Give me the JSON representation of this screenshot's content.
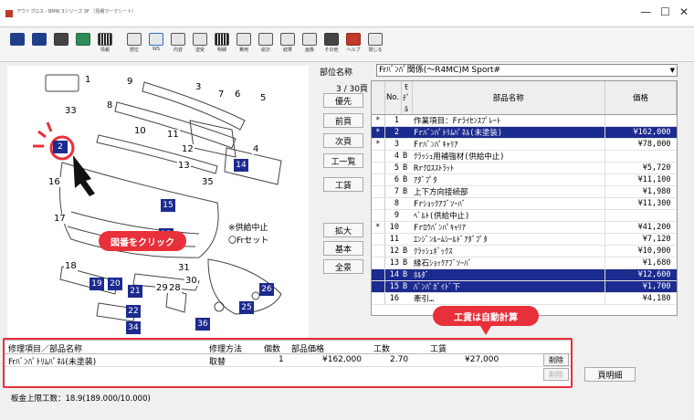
{
  "window": {
    "title": "アウトプロス - BMW 3シリーズ 3F （見積ワークシート）",
    "controls": [
      "—",
      "☐",
      "✕"
    ]
  },
  "toolbar": {
    "buttons": [
      {
        "icon": "save-icon",
        "label": ""
      },
      {
        "icon": "save-as-icon",
        "label": ""
      },
      {
        "icon": "print-icon",
        "label": ""
      },
      {
        "icon": "exit-icon",
        "label": ""
      },
      {
        "icon": "info-icon",
        "label": "情報"
      },
      {
        "icon": "parts-icon",
        "label": "部位"
      },
      {
        "icon": "ws-icon",
        "label": "WS"
      },
      {
        "icon": "internal-icon",
        "label": "内容"
      },
      {
        "icon": "transfer-icon",
        "label": "送受"
      },
      {
        "icon": "detail-icon",
        "label": "明細"
      },
      {
        "icon": "cost-icon",
        "label": "費用"
      },
      {
        "icon": "total-icon",
        "label": "総計"
      },
      {
        "icon": "result-icon",
        "label": "結果"
      },
      {
        "icon": "image-icon",
        "label": "画像"
      },
      {
        "icon": "other-icon",
        "label": "その他"
      },
      {
        "icon": "help-icon",
        "label": "ヘルプ"
      },
      {
        "icon": "close-icon",
        "label": "閉じる"
      }
    ]
  },
  "diagram": {
    "callout": "図番をクリック",
    "legend_discontinued": "※供給中止",
    "legend_set": "〇Frセット",
    "selected_number": "2",
    "numbers_plain": [
      "1",
      "3",
      "7",
      "6",
      "5",
      "8",
      "9",
      "10",
      "4",
      "11",
      "12",
      "13",
      "16",
      "17",
      "18",
      "31",
      "33",
      "29",
      "28",
      "30",
      "35"
    ],
    "numbers_boxed": [
      "2",
      "14",
      "15",
      "19",
      "20",
      "21",
      "22",
      "23",
      "25",
      "26",
      "34",
      "36"
    ]
  },
  "panel": {
    "model_label": "部位名称",
    "model_value": "Frﾊﾞﾝﾊﾟ関係(〜R4MC)M Sport#",
    "page_count": "3 / 30頁",
    "nav": [
      "優先",
      "前頁",
      "次頁",
      "工一覧"
    ],
    "labor_button": "工賃",
    "zoom": [
      "拡大",
      "基本",
      "全景"
    ]
  },
  "parts_table": {
    "headers": [
      "No.",
      "ﾓﾃﾞﾙ",
      "部品名称",
      "価格"
    ],
    "rows": [
      {
        "star": "*",
        "no": "1",
        "code": "",
        "name": "作業項目：Frﾗｲｾﾝｽﾌﾟﾚｰﾄ",
        "price": "",
        "hl": false
      },
      {
        "star": "*",
        "no": "2",
        "code": "",
        "name": "Frﾊﾞﾝﾊﾟﾄﾘﾑﾊﾟﾈﾙ(未塗装)",
        "price": "¥162,000",
        "hl": true
      },
      {
        "star": "*",
        "no": "3",
        "code": "",
        "name": "Frﾊﾞﾝﾊﾟｷｬﾘｱ",
        "price": "¥78,000",
        "hl": false
      },
      {
        "star": "",
        "no": "4",
        "code": "B",
        "name": "ｸﾗｯｼｭ用補強材(供給中止)",
        "price": "",
        "hl": false
      },
      {
        "star": "",
        "no": "5",
        "code": "B",
        "name": "Rrｸﾛｽｽﾄﾗｯﾄ",
        "price": "¥5,720",
        "hl": false
      },
      {
        "star": "",
        "no": "6",
        "code": "B",
        "name": "ｱﾀﾞﾌﾟﾀ",
        "price": "¥11,100",
        "hl": false
      },
      {
        "star": "",
        "no": "7",
        "code": "B",
        "name": "上下方向接続部",
        "price": "¥1,980",
        "hl": false
      },
      {
        "star": "",
        "no": "8",
        "code": "",
        "name": "Frｼｮｯｸｱﾌﾞｿｰﾊﾞ",
        "price": "¥11,300",
        "hl": false
      },
      {
        "star": "",
        "no": "9",
        "code": "",
        "name": "ﾍﾞﾙﾄ(供給中止)",
        "price": "",
        "hl": false
      },
      {
        "star": "*",
        "no": "10",
        "code": "",
        "name": "Frﾛｳﾊﾞﾝﾊﾟｷｬﾘｱ",
        "price": "¥41,200",
        "hl": false
      },
      {
        "star": "",
        "no": "11",
        "code": "",
        "name": "ｴﾝｼﾞﾝﾙｰﾑｼｰﾙﾄﾞｱﾀﾞﾌﾟﾀ",
        "price": "¥7,120",
        "hl": false
      },
      {
        "star": "",
        "no": "12",
        "code": "B",
        "name": "ｸﾗｯｼｭﾎﾞｯｸｽ",
        "price": "¥10,900",
        "hl": false
      },
      {
        "star": "",
        "no": "13",
        "code": "B",
        "name": "縁石ｼｮｯｸｱﾌﾞｿｰﾊﾞ",
        "price": "¥1,680",
        "hl": false
      },
      {
        "star": "",
        "no": "14",
        "code": "B",
        "name": "ﾎﾙﾀﾞ",
        "price": "¥12,600",
        "hl": true
      },
      {
        "star": "",
        "no": "15",
        "code": "B",
        "name": "ﾊﾞﾝﾊﾟｶﾞｲﾄﾞ下",
        "price": "¥1,700",
        "hl": true
      },
      {
        "star": "",
        "no": "16",
        "code": "",
        "name": "牽引…",
        "price": "¥4,180",
        "hl": false
      }
    ]
  },
  "work": {
    "badge": "工賃は自動計算",
    "headers": [
      "修理項目／部品名称",
      "修理方法",
      "個数",
      "部品価格",
      "工数",
      "工賃"
    ],
    "row": [
      "Frﾊﾞﾝﾊﾟﾄﾘﾑﾊﾟﾈﾙ(未塗装)",
      "取替",
      "1",
      "¥162,000",
      "2.70",
      "¥27,000"
    ],
    "delete_label": "削除",
    "delete_disabled_label": "削除",
    "detail_button": "頁明細"
  },
  "status": {
    "text": "板金上限工数：18.9(189.000/10.000)"
  }
}
